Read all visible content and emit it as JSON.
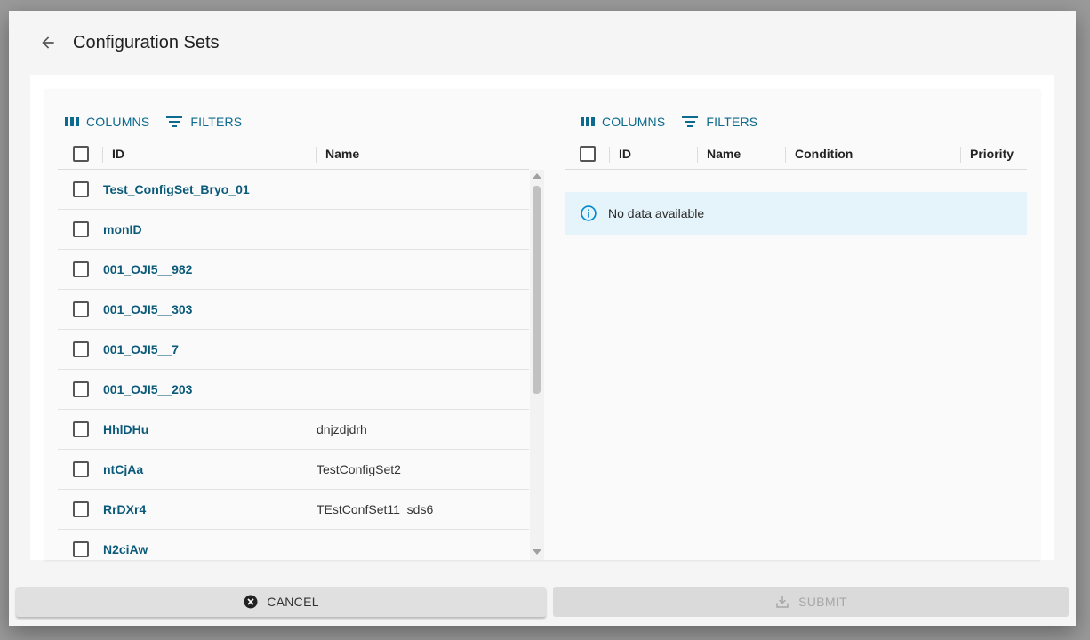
{
  "dialog": {
    "title": "Configuration Sets"
  },
  "left_grid": {
    "toolbar": {
      "columns_label": "COLUMNS",
      "filters_label": "FILTERS"
    },
    "columns": [
      "ID",
      "Name"
    ],
    "rows": [
      {
        "id": "Test_ConfigSet_Bryo_01",
        "name": ""
      },
      {
        "id": "monID",
        "name": ""
      },
      {
        "id": "001_OJI5__982",
        "name": ""
      },
      {
        "id": "001_OJI5__303",
        "name": ""
      },
      {
        "id": "001_OJI5__7",
        "name": ""
      },
      {
        "id": "001_OJI5__203",
        "name": ""
      },
      {
        "id": "HhlDHu",
        "name": "dnjzdjdrh"
      },
      {
        "id": "ntCjAa",
        "name": "TestConfigSet2"
      },
      {
        "id": "RrDXr4",
        "name": "TEstConfSet11_sds6"
      },
      {
        "id": "N2ciAw",
        "name": ""
      }
    ]
  },
  "right_grid": {
    "toolbar": {
      "columns_label": "COLUMNS",
      "filters_label": "FILTERS"
    },
    "columns": [
      "ID",
      "Name",
      "Condition",
      "Priority"
    ],
    "empty_message": "No data available"
  },
  "actions": {
    "cancel_label": "CANCEL",
    "submit_label": "SUBMIT"
  },
  "colors": {
    "accent": "#0b6a8d",
    "link": "#0b5a7a",
    "info_bg": "#e5f4fa",
    "info_icon": "#0288d1"
  },
  "icons": {
    "back": "arrow-left-icon",
    "columns": "view-column-icon",
    "filters": "filter-list-icon",
    "info": "info-outline-icon",
    "cancel": "cancel-circle-icon",
    "submit": "download-icon"
  }
}
